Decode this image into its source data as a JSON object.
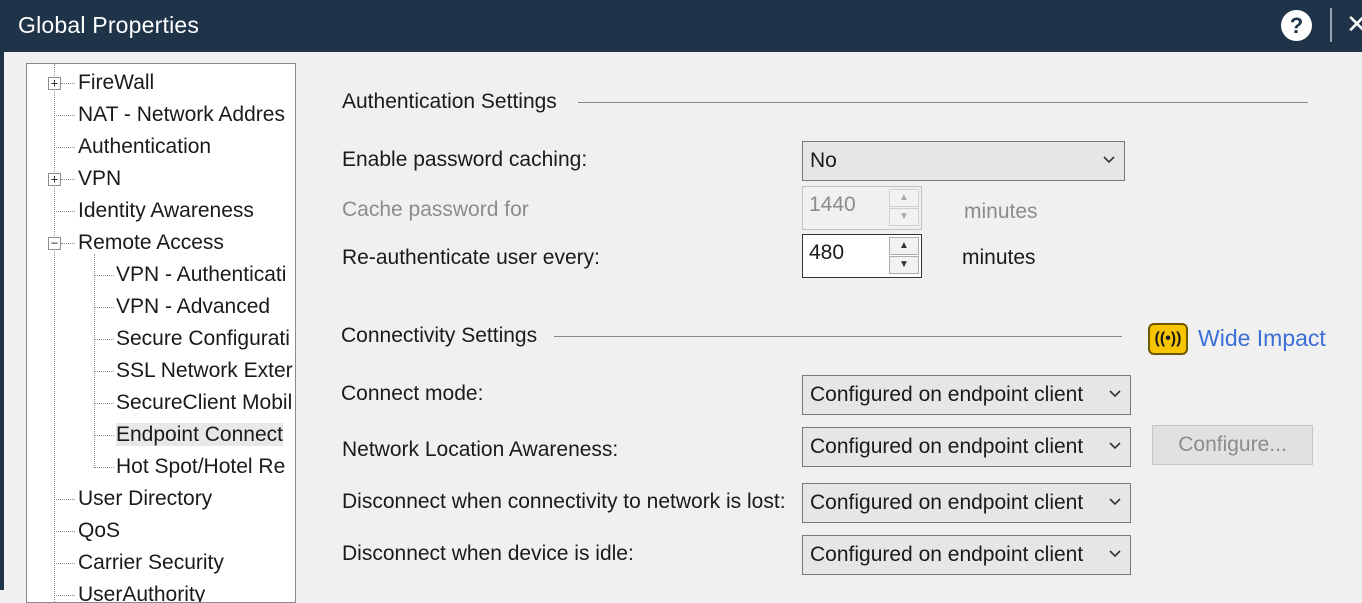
{
  "window": {
    "title": "Global Properties",
    "help_glyph": "?",
    "close_glyph": "✕"
  },
  "tree": {
    "items": [
      {
        "label": "FireWall",
        "expander": "+"
      },
      {
        "label": "NAT - Network Addres"
      },
      {
        "label": "Authentication"
      },
      {
        "label": "VPN",
        "expander": "+"
      },
      {
        "label": "Identity Awareness"
      },
      {
        "label": "Remote Access",
        "expander": "−"
      },
      {
        "label": "VPN - Authenticati"
      },
      {
        "label": "VPN - Advanced"
      },
      {
        "label": "Secure Configurati"
      },
      {
        "label": "SSL Network Exter"
      },
      {
        "label": "SecureClient Mobil"
      },
      {
        "label": "Endpoint Connect",
        "selected": true
      },
      {
        "label": "Hot Spot/Hotel Re"
      },
      {
        "label": "User Directory"
      },
      {
        "label": "QoS"
      },
      {
        "label": "Carrier Security"
      },
      {
        "label": "UserAuthority"
      }
    ]
  },
  "auth": {
    "section_title": "Authentication Settings",
    "enable_caching_label": "Enable password caching:",
    "enable_caching_value": "No",
    "cache_for_label": "Cache password for",
    "cache_for_value": "1440",
    "cache_for_unit": "minutes",
    "reauth_label": "Re-authenticate user every:",
    "reauth_value": "480",
    "reauth_unit": "minutes",
    "spin_up": "▲",
    "spin_down": "▼"
  },
  "connectivity": {
    "section_title": "Connectivity Settings",
    "impact_icon": "broadcast-icon",
    "impact_glyph": "((•))",
    "impact_label": "Wide Impact",
    "connect_mode_label": "Connect mode:",
    "connect_mode_value": "Configured on endpoint client",
    "nla_label": "Network Location Awareness:",
    "nla_value": "Configured on endpoint client",
    "configure_button": "Configure...",
    "disconnect_lost_label": "Disconnect when connectivity to network is lost:",
    "disconnect_lost_value": "Configured on endpoint client",
    "disconnect_idle_label": "Disconnect when device is idle:",
    "disconnect_idle_value": "Configured on endpoint client"
  },
  "colors": {
    "titlebar": "#1f3349",
    "impact_yellow": "#f6c500",
    "link_blue": "#3b6fd6"
  }
}
